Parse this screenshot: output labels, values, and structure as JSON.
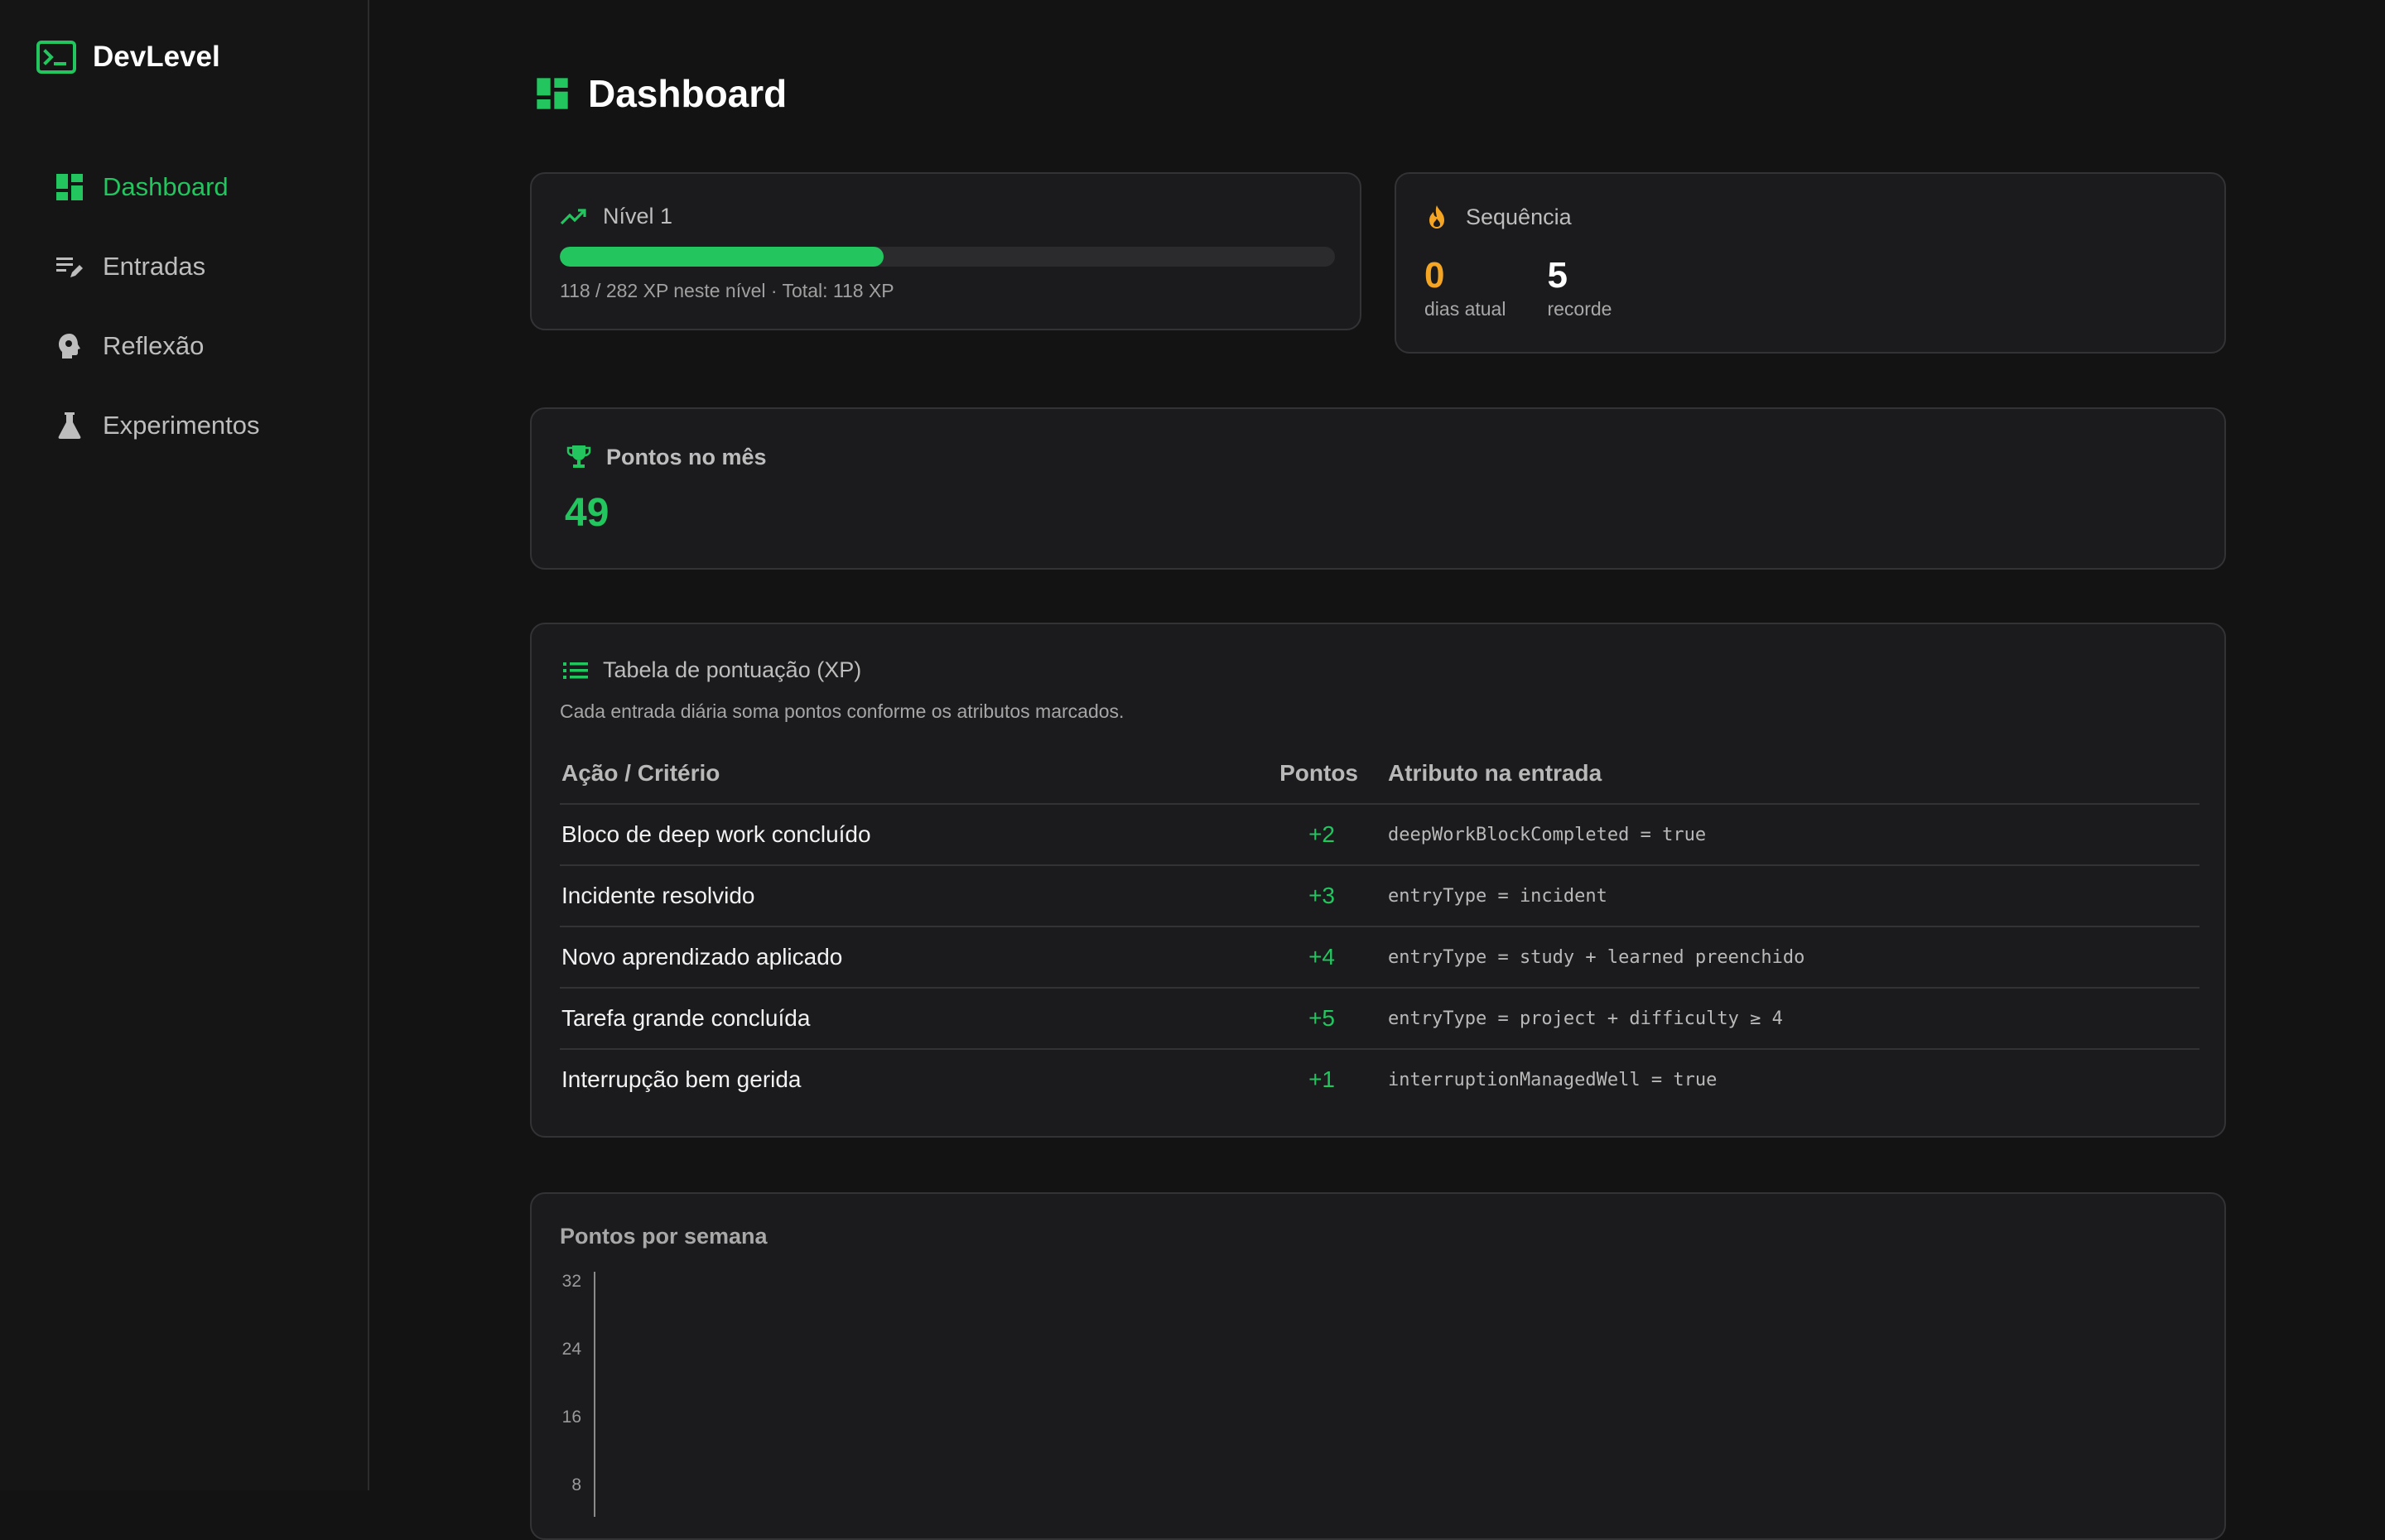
{
  "app": {
    "name": "DevLevel"
  },
  "sidebar": {
    "items": [
      {
        "label": "Dashboard",
        "icon": "dashboard-icon",
        "active": true
      },
      {
        "label": "Entradas",
        "icon": "edit-list-icon",
        "active": false
      },
      {
        "label": "Reflexão",
        "icon": "head-gear-icon",
        "active": false
      },
      {
        "label": "Experimentos",
        "icon": "flask-icon",
        "active": false
      }
    ]
  },
  "page": {
    "title": "Dashboard"
  },
  "level": {
    "title": "Nível 1",
    "progress_fraction": 0.418,
    "subtitle": "118 / 282 XP neste nível · Total: 118 XP"
  },
  "streak": {
    "title": "Sequência",
    "current_value": "0",
    "current_label": "dias atual",
    "record_value": "5",
    "record_label": "recorde"
  },
  "month_points": {
    "title": "Pontos no mês",
    "value": "49"
  },
  "xp_table": {
    "title": "Tabela de pontuação (XP)",
    "description": "Cada entrada diária soma pontos conforme os atributos marcados.",
    "headers": {
      "action": "Ação / Critério",
      "points": "Pontos",
      "attribute": "Atributo na entrada"
    },
    "rows": [
      {
        "action": "Bloco de deep work concluído",
        "points": "+2",
        "attribute": "deepWorkBlockCompleted = true"
      },
      {
        "action": "Incidente resolvido",
        "points": "+3",
        "attribute": "entryType = incident"
      },
      {
        "action": "Novo aprendizado aplicado",
        "points": "+4",
        "attribute": "entryType = study + learned preenchido"
      },
      {
        "action": "Tarefa grande concluída",
        "points": "+5",
        "attribute": "entryType = project + difficulty ≥ 4"
      },
      {
        "action": "Interrupção bem gerida",
        "points": "+1",
        "attribute": "interruptionManagedWell = true"
      }
    ]
  },
  "colors": {
    "accent": "#22c55e",
    "streak": "#f5a524",
    "background": "#131313",
    "card": "#1b1b1d"
  },
  "chart_data": {
    "type": "bar",
    "title": "Pontos por semana",
    "y_ticks": [
      32,
      24,
      16,
      8
    ],
    "ylim": [
      0,
      32
    ]
  }
}
